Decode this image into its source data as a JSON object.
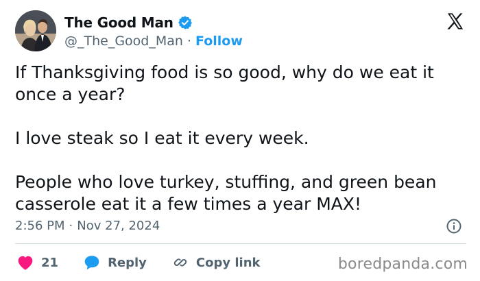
{
  "author": {
    "display_name": "The Good Man",
    "handle": "@_The_Good_Man",
    "separator": "·",
    "follow_label": "Follow",
    "avatar_icon": "profile-photo",
    "verified_icon": "verified-badge-icon"
  },
  "header": {
    "logo_icon": "x-logo-icon"
  },
  "tweet": {
    "paragraphs": [
      "If Thanksgiving food is so good, why do we eat it once a year?",
      "I love steak so I eat it every week.",
      "People who love turkey, stuffing, and green bean casserole eat it a few times a year MAX!"
    ],
    "time": "2:56 PM",
    "separator": "·",
    "date": "Nov 27, 2024",
    "info_icon": "info-icon"
  },
  "actions": {
    "likes_count": "21",
    "reply_label": "Reply",
    "copy_link_label": "Copy link",
    "like_icon": "heart-icon",
    "reply_icon": "speech-bubble-icon",
    "copy_icon": "link-icon"
  },
  "watermark": {
    "text": "boredpanda.com"
  },
  "colors": {
    "accent": "#1d9bf0",
    "like": "#f91880",
    "text": "#0f1419",
    "muted": "#536471",
    "divider": "#cfd9de"
  }
}
